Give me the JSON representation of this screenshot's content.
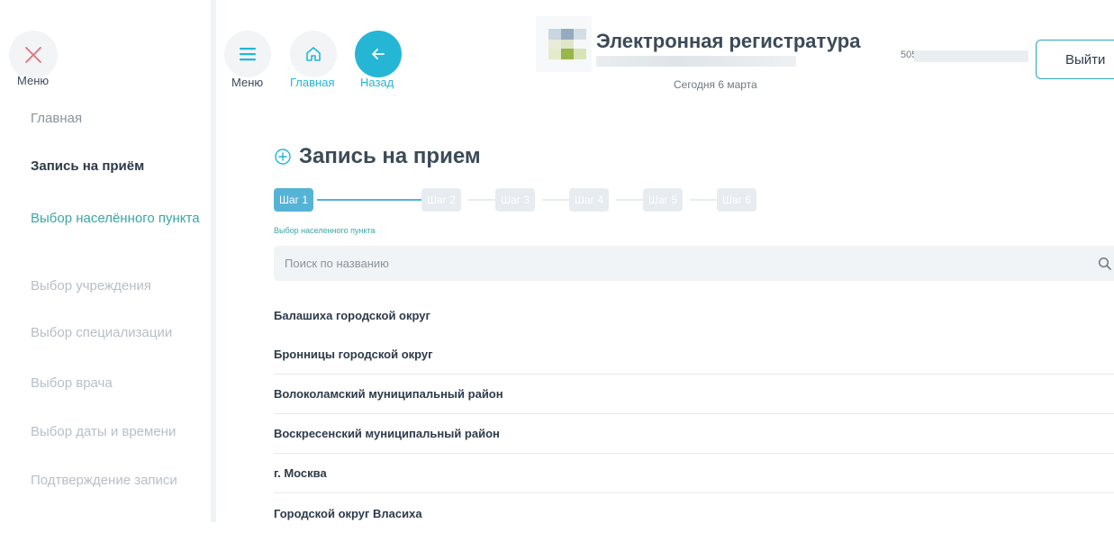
{
  "sidebar": {
    "close_label": "Меню",
    "items": [
      {
        "label": "Главная"
      },
      {
        "label": "Запись на приём"
      },
      {
        "label": "Выбор населённого пункта"
      },
      {
        "label": "Выбор учреждения"
      },
      {
        "label": "Выбор специализации"
      },
      {
        "label": "Выбор врача"
      },
      {
        "label": "Выбор даты и времени"
      },
      {
        "label": "Подтверждение записи"
      }
    ]
  },
  "topbar": {
    "menu_label": "Меню",
    "home_label": "Главная",
    "back_label": "Назад",
    "brand_title": "Электронная регистратура",
    "today": "Сегодня 6 марта",
    "phone_prefix": "505",
    "logout_label": "Выйти"
  },
  "main": {
    "title": "Запись на прием",
    "steps": [
      "Шаг 1",
      "Шаг 2",
      "Шаг 3",
      "Шаг 4",
      "Шаг 5",
      "Шаг 6"
    ],
    "step_caption": "Выбор населенного пункта",
    "search_placeholder": "Поиск по названию",
    "locations": [
      "Балашиха городской округ",
      "Бронницы городской округ",
      "Волоколамский муниципальный район",
      "Воскресенский муниципальный район",
      "г. Москва",
      "Городской округ Власиха"
    ]
  },
  "colors": {
    "accent": "#25b6d6",
    "step_active": "#55b3d6",
    "teal_text": "#3aa6a8",
    "close_x": "#e3707b"
  }
}
